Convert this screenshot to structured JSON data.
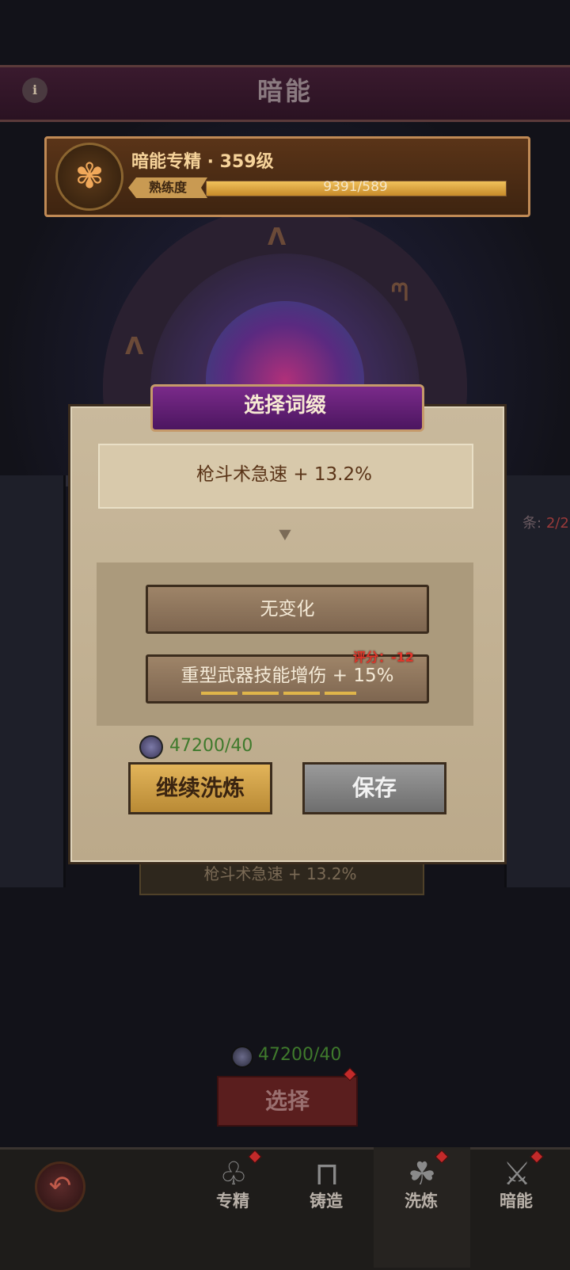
{
  "header": {
    "title": "暗能",
    "info_icon": "info-icon"
  },
  "mastery": {
    "title": "暗能专精 · 359级",
    "progress_tag": "熟练度",
    "progress_text": "9391/589",
    "progress_fraction": 1.0
  },
  "dialog": {
    "title": "选择词缀",
    "current_affix": "枪斗术急速 + 13.2%",
    "options": [
      {
        "label": "无变化"
      },
      {
        "label": "重型武器技能增伤 + 15%",
        "score": "评分：-12"
      }
    ],
    "cost": "47200/40",
    "continue_label": "继续洗炼",
    "save_label": "保存"
  },
  "background": {
    "ghost_affix": "枪斗术急速 + 13.2%",
    "side_label": "条:",
    "side_value": "2/2"
  },
  "bottom": {
    "cost": "47200/40",
    "select_label": "选择"
  },
  "nav": {
    "items": [
      {
        "label": "专精",
        "icon": "tree-icon"
      },
      {
        "label": "铸造",
        "icon": "anvil-icon"
      },
      {
        "label": "洗炼",
        "icon": "triquetra-icon"
      },
      {
        "label": "暗能",
        "icon": "sword-icon"
      }
    ],
    "active_index": 2
  },
  "colors": {
    "accent_gold": "#e2b45a",
    "cost_green": "#3f7a2c",
    "score_red": "#e0362a",
    "dialog_header_purple": "#7a2a8a"
  }
}
